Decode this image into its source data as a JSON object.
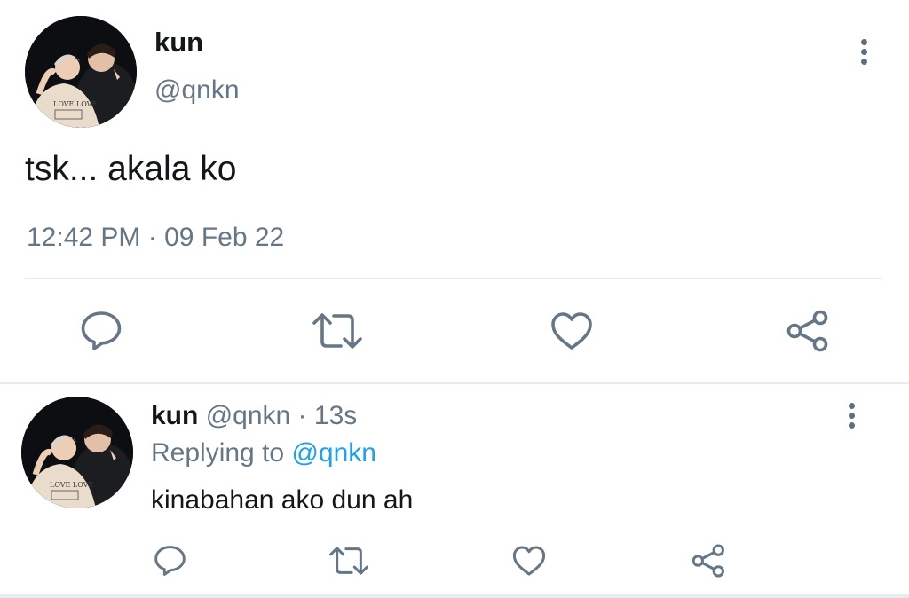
{
  "main_tweet": {
    "display_name": "kun",
    "handle": "@qnkn",
    "text": "tsk... akala ko",
    "time": "12:42 PM",
    "dot": "·",
    "date": "09 Feb 22",
    "avatar_shirt_text": "LOVE LOVE"
  },
  "reply": {
    "display_name": "kun",
    "handle": "@qnkn",
    "dot": "·",
    "age": "13s",
    "replying_prefix": "Replying to",
    "replying_to": "@qnkn",
    "text": "kinabahan ako dun ah",
    "avatar_shirt_text": "LOVE LOVE"
  },
  "icons": {
    "reply": "speech-bubble-icon",
    "retweet": "retweet-icon",
    "like": "heart-icon",
    "share": "share-icon",
    "more": "vertical-dots-icon"
  },
  "colors": {
    "text": "#14171a",
    "muted": "#657786",
    "link": "#1da1f2",
    "divider": "#e6ecf0"
  }
}
